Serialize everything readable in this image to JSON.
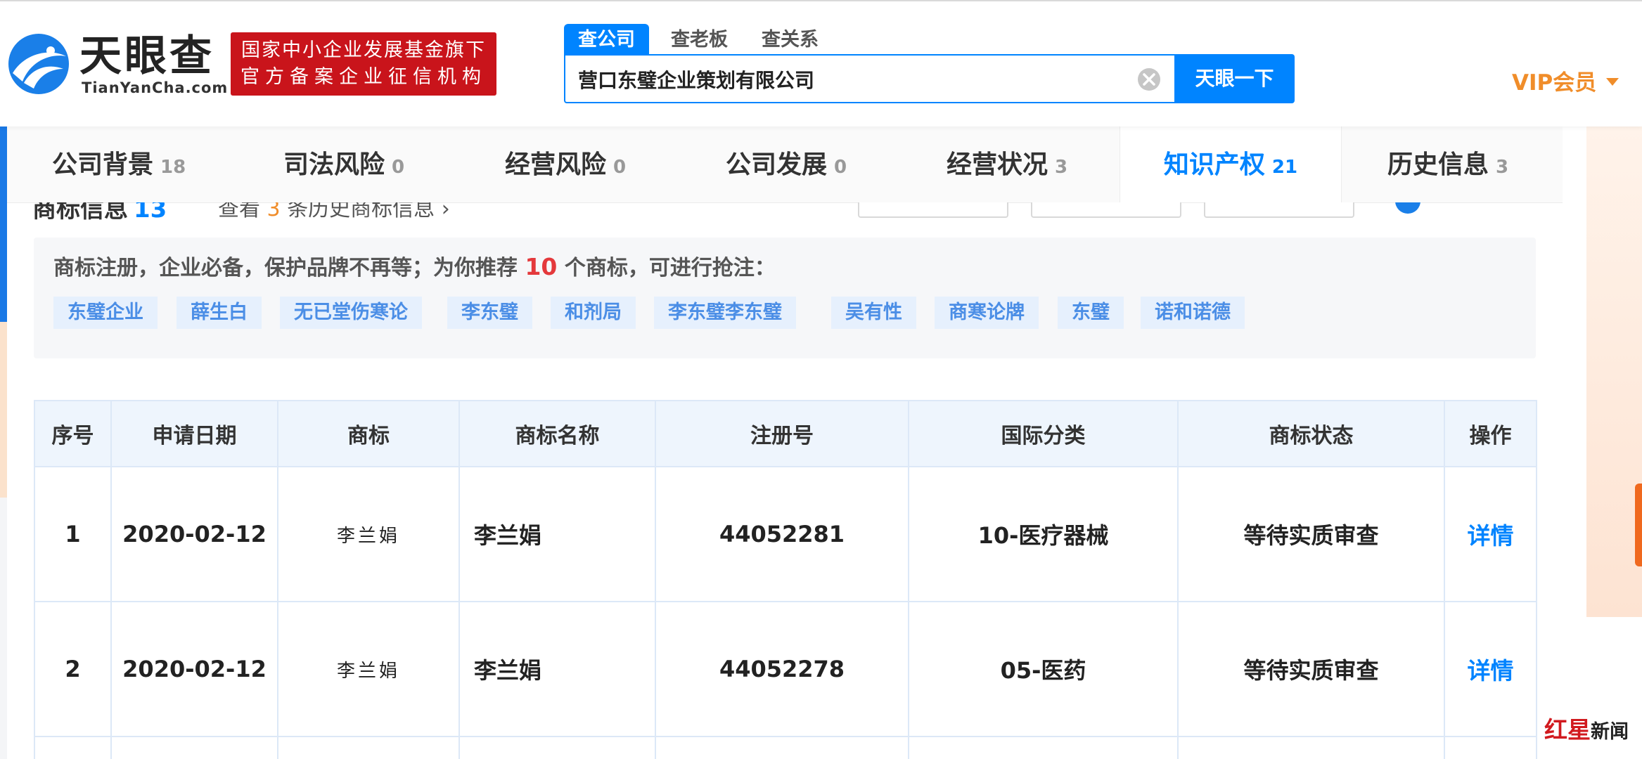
{
  "brand": {
    "name_cn": "天眼查",
    "name_en": "TianYanCha.com",
    "badge_line1": "国家中小企业发展基金旗下",
    "badge_line2": "官方备案企业征信机构",
    "colors": {
      "primary": "#0084ff",
      "badge": "#c9141b",
      "vip": "#f08d2a"
    }
  },
  "search": {
    "tabs": [
      "查公司",
      "查老板",
      "查关系"
    ],
    "active_tab": "查公司",
    "value": "营口东璧企业策划有限公司",
    "button_label": "天眼一下"
  },
  "vip": {
    "label": "VIP会员"
  },
  "nav": {
    "items": [
      {
        "label": "公司背景",
        "count": "18"
      },
      {
        "label": "司法风险",
        "count": "0"
      },
      {
        "label": "经营风险",
        "count": "0"
      },
      {
        "label": "公司发展",
        "count": "0"
      },
      {
        "label": "经营状况",
        "count": "3"
      },
      {
        "label": "知识产权",
        "count": "21"
      },
      {
        "label": "历史信息",
        "count": "3"
      }
    ],
    "active": "知识产权"
  },
  "section": {
    "title": "商标信息",
    "count": "13",
    "history_prefix": "查看",
    "history_count": "3",
    "history_suffix": "条历史商标信息 ›"
  },
  "recommend": {
    "text_before": "商标注册，企业必备，保护品牌不再等；为你推荐",
    "count": "10",
    "text_after": "个商标，可进行抢注：",
    "tags": [
      "东璧企业",
      "薛生白",
      "无已堂伤寒论",
      "李东璧",
      "和剂局",
      "李东璧李东璧",
      "吴有性",
      "商寒论牌",
      "东璧",
      "诺和诺德"
    ]
  },
  "table": {
    "headers": [
      "序号",
      "申请日期",
      "商标",
      "商标名称",
      "注册号",
      "国际分类",
      "商标状态",
      "操作"
    ],
    "rows": [
      {
        "index": "1",
        "date": "2020-02-12",
        "logo_text": "李兰娟",
        "name": "李兰娟",
        "reg_no": "44052281",
        "class": "10-医疗器械",
        "status": "等待实质审查",
        "action": "详情"
      },
      {
        "index": "2",
        "date": "2020-02-12",
        "logo_text": "李兰娟",
        "name": "李兰娟",
        "reg_no": "44052278",
        "class": "05-医药",
        "status": "等待实质审查",
        "action": "详情"
      }
    ]
  },
  "watermark": {
    "red": "红星",
    "dark": "新闻"
  }
}
